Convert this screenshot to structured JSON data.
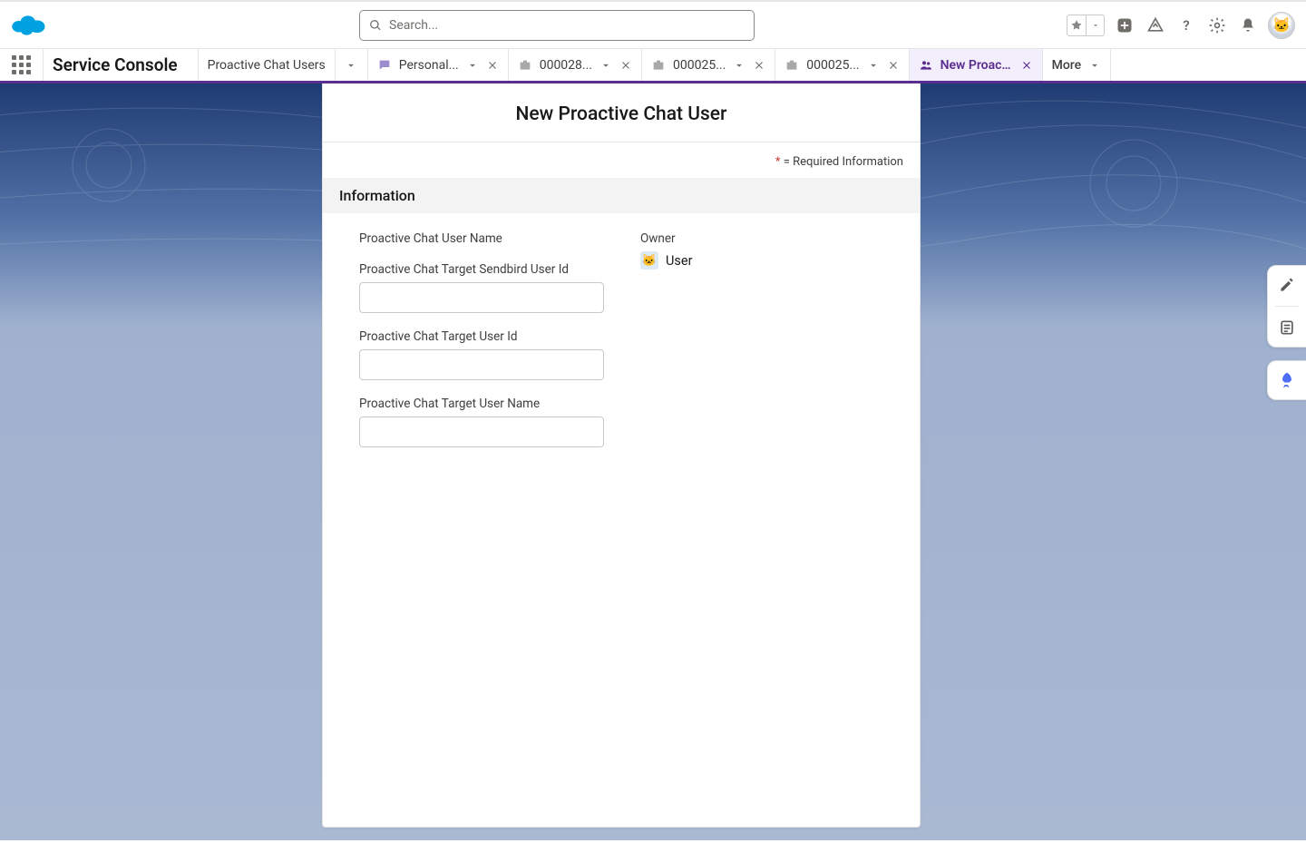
{
  "header": {
    "search_placeholder": "Search..."
  },
  "nav": {
    "app_name": "Service Console",
    "tabs": [
      {
        "label": "Proactive Chat Users",
        "icon": "none",
        "dropdown": true,
        "closable": false
      },
      {
        "label": "Personal...",
        "icon": "chat",
        "dropdown": true,
        "closable": true
      },
      {
        "label": "000028...",
        "icon": "case",
        "dropdown": true,
        "closable": true
      },
      {
        "label": "000025...",
        "icon": "case",
        "dropdown": true,
        "closable": true
      },
      {
        "label": "000025...",
        "icon": "case",
        "dropdown": true,
        "closable": true
      },
      {
        "label": "New Proacti...",
        "icon": "people",
        "dropdown": false,
        "closable": true,
        "active": true
      }
    ],
    "more_label": "More"
  },
  "panel": {
    "title": "New Proactive Chat User",
    "required_note_symbol": "*",
    "required_note_text": " = Required Information",
    "section_heading": "Information",
    "owner_label": "Owner",
    "owner_value": "User",
    "fields": [
      {
        "label": "Proactive Chat User Name",
        "has_input": false
      },
      {
        "label": "Proactive Chat Target Sendbird User Id",
        "has_input": true,
        "value": ""
      },
      {
        "label": "Proactive Chat Target User Id",
        "has_input": true,
        "value": ""
      },
      {
        "label": "Proactive Chat Target User Name",
        "has_input": true,
        "value": ""
      }
    ]
  },
  "icons": {
    "star": "star-icon",
    "plus": "plus-icon",
    "trailhead": "trailhead-icon",
    "help": "help-icon",
    "settings": "gear-icon",
    "notifications": "bell-icon",
    "avatar": "avatar-icon",
    "edit": "edit-icon",
    "note": "note-icon",
    "rocket": "rocket-icon"
  }
}
